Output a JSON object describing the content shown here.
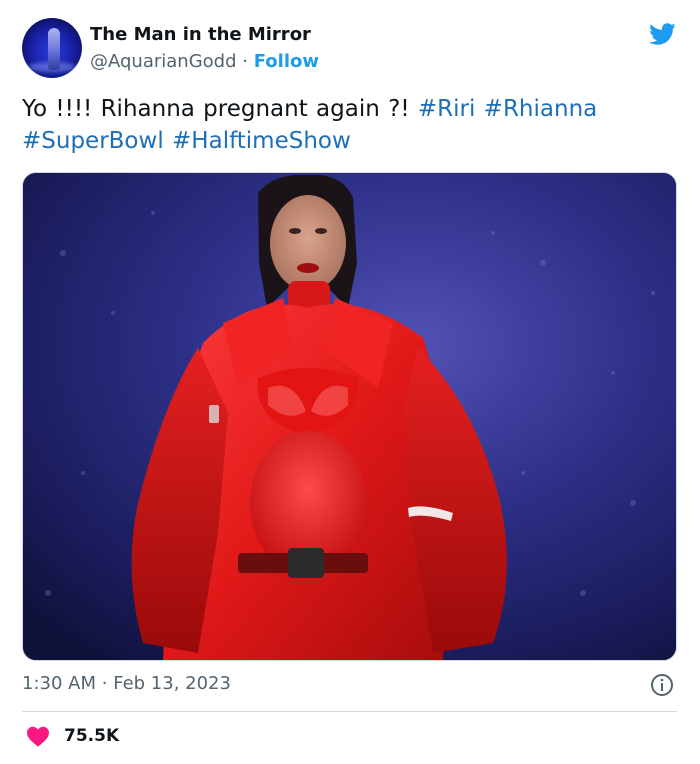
{
  "user": {
    "display_name": "The Man in the Mirror",
    "handle": "@AquarianGodd",
    "separator": "·",
    "follow_label": "Follow"
  },
  "tweet": {
    "text_prefix": "Yo !!!! Rihanna pregnant again ?!",
    "hashtags": [
      "#Riri",
      "#Rhianna",
      "#SuperBowl",
      "#HalftimeShow"
    ]
  },
  "meta": {
    "time": "1:30 AM",
    "separator": "·",
    "date": "Feb 13, 2023"
  },
  "engagement": {
    "likes": "75.5K"
  },
  "icons": {
    "logo": "twitter-bird-icon",
    "info": "info-icon",
    "like": "heart-icon"
  },
  "colors": {
    "brand_blue": "#1d9bf0",
    "hashtag_blue": "#1d6fb8",
    "heart_pink": "#f91880",
    "text_primary": "#0f1419",
    "text_secondary": "#536471",
    "divider": "#cfd9de"
  }
}
